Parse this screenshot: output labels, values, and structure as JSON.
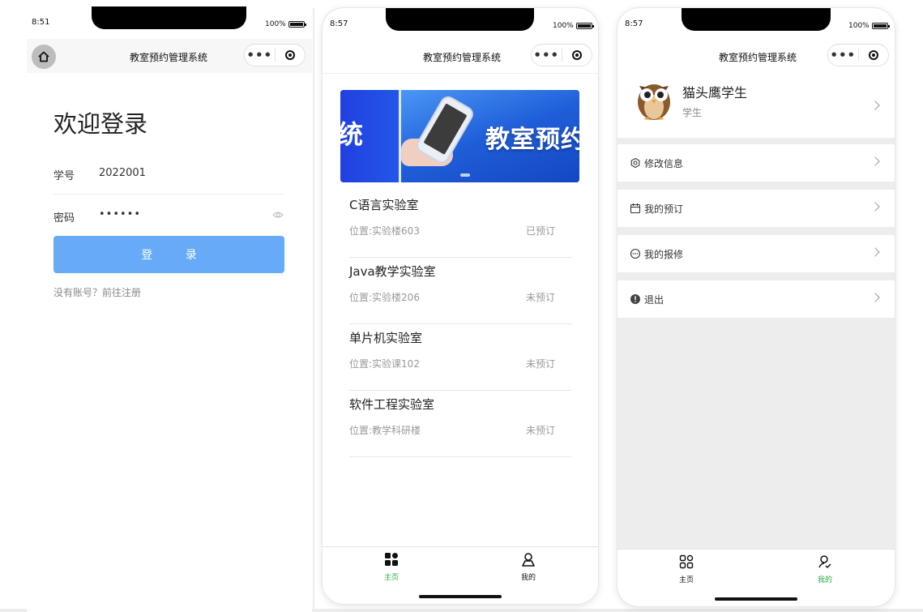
{
  "common": {
    "app_title": "教室预约管理系统",
    "capsule_menu": "•••",
    "battery": "100%"
  },
  "login": {
    "time": "8:51",
    "title": "欢迎登录",
    "student_id_label": "学号",
    "student_id_value": "2022001",
    "password_label": "密码",
    "password_value": "••••••",
    "login_button": "登 录",
    "register_link": "没有账号？前往注册"
  },
  "home": {
    "time": "8:57",
    "banner": {
      "left_text": "统",
      "right_text": "教室预约"
    },
    "rooms": [
      {
        "name": "C语言实验室",
        "location": "位置:实验楼603",
        "status": "已预订"
      },
      {
        "name": "Java教学实验室",
        "location": "位置:实验楼206",
        "status": "未预订"
      },
      {
        "name": "单片机实验室",
        "location": "位置:实验课102",
        "status": "未预订"
      },
      {
        "name": "软件工程实验室",
        "location": "位置:教学科研楼",
        "status": "未预订"
      }
    ]
  },
  "profile": {
    "time": "8:57",
    "user_name": "猫头鹰学生",
    "user_role": "学生",
    "menu": [
      {
        "label": "修改信息",
        "icon": "settings-icon"
      },
      {
        "label": "我的预订",
        "icon": "calendar-icon"
      },
      {
        "label": "我的报修",
        "icon": "message-icon"
      },
      {
        "label": "退出",
        "icon": "alert-icon"
      }
    ]
  },
  "tabbar": {
    "home_label": "主页",
    "mine_label": "我的",
    "active_color": "#2aae41",
    "inactive_color": "#111111"
  },
  "colors": {
    "primary_button": "#66aaf8",
    "banner_blue": "#1f5bd6",
    "page_gray": "#ededed"
  }
}
